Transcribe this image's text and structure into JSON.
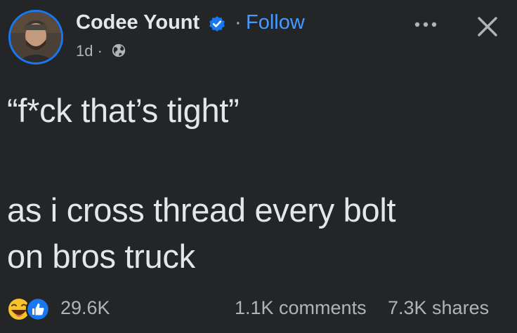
{
  "header": {
    "author_name": "Codee Yount",
    "separator": "·",
    "follow_label": "Follow",
    "time": "1d ·",
    "verified_icon": "verified-badge-icon",
    "privacy_icon": "globe-icon",
    "more_icon": "more-dots-icon",
    "close_icon": "close-x-icon"
  },
  "post": {
    "line1": "“f*ck that’s tight”",
    "line2": "as i cross thread every bolt",
    "line3": "on bros truck"
  },
  "footer": {
    "reaction_icons": [
      "haha-reaction-icon",
      "like-reaction-icon"
    ],
    "reaction_count": "29.6K",
    "comments": "1.1K comments",
    "shares": "7.3K shares"
  },
  "colors": {
    "background": "#242526",
    "text": "#e4e6eb",
    "secondary": "#b0b3b8",
    "accent": "#1877f2",
    "follow": "#4599ff"
  }
}
